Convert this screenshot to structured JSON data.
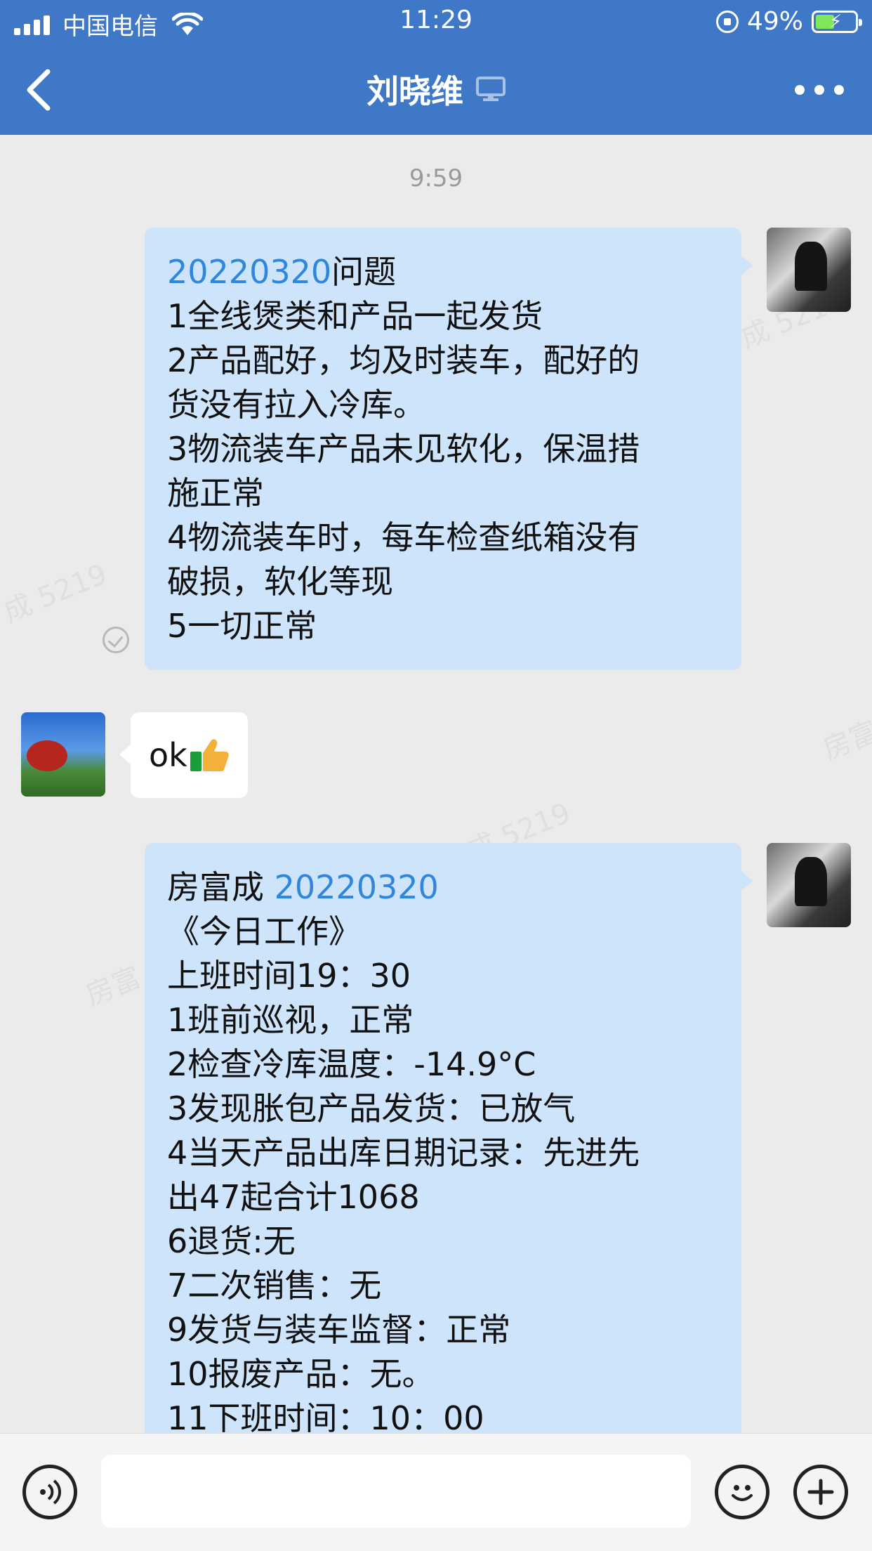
{
  "status_bar": {
    "carrier": "中国电信",
    "time": "11:29",
    "battery": "49%",
    "battery_level": 0.49
  },
  "nav": {
    "title": "刘晓维",
    "icons": [
      "back-icon",
      "computer-icon",
      "more-icon"
    ]
  },
  "chat": {
    "timestamp": "9:59",
    "watermarks": [
      "成 5219",
      "房富",
      "成 5219",
      "房富"
    ],
    "messages": [
      {
        "sender": "me",
        "lines": [
          {
            "link": "20220320",
            "text": "问题"
          },
          {
            "text": "1全线煲类和产品一起发货"
          },
          {
            "text": "2产品配好，均及时装车，配好的"
          },
          {
            "text": "货没有拉入冷库。"
          },
          {
            "text": "3物流装车产品未见软化，保温措"
          },
          {
            "text": "施正常"
          },
          {
            "text": "4物流装车时，每车检查纸箱没有"
          },
          {
            "text": "破损，软化等现"
          },
          {
            "text": "5一切正常"
          }
        ]
      },
      {
        "sender": "other",
        "text": "ok",
        "emoji": "thumbs-up"
      },
      {
        "sender": "me",
        "lines": [
          {
            "text": "房富成 ",
            "link": "20220320"
          },
          {
            "text": "《今日工作》"
          },
          {
            "text": "上班时间19：30"
          },
          {
            "text": "1班前巡视，正常"
          },
          {
            "text": "2检查冷库温度：-14.9°C"
          },
          {
            "text": "3发现胀包产品发货：已放气"
          },
          {
            "text": "4当天产品出库日期记录：先进先"
          },
          {
            "text": "出47起合计1068"
          },
          {
            "text": "6退货:无"
          },
          {
            "text": "7二次销售：无"
          },
          {
            "text": "9发货与装车监督：正常"
          },
          {
            "text": "10报废产品：无。"
          },
          {
            "text": "11下班时间：10：00"
          }
        ]
      }
    ]
  },
  "input_bar": {
    "icons": [
      "voice-icon",
      "emoji-icon",
      "plus-icon"
    ],
    "input_value": ""
  }
}
